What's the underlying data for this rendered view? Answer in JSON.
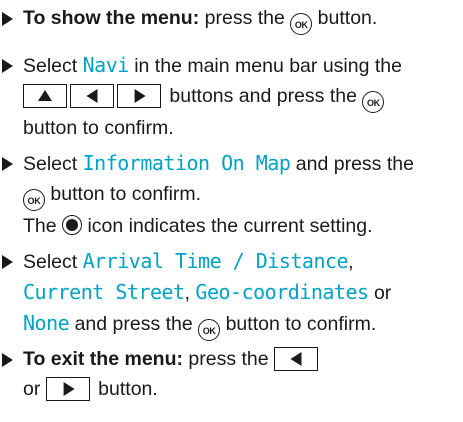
{
  "ok_label": "OK",
  "steps": [
    {
      "bold": "To show the menu:",
      "a": " press the ",
      "b": " button."
    },
    {
      "a": "Select ",
      "hl1": "Navi",
      "b": " in the main menu bar using the",
      "c": " buttons and press the ",
      "d": "button to confirm."
    },
    {
      "a": "Select ",
      "hl1": "Information On Map",
      "b": " and press the",
      "c": " button to confirm.",
      "d": "The ",
      "e": " icon indicates the current setting."
    },
    {
      "a": "Select ",
      "hl1": "Arrival Time / Distance",
      "b": ",",
      "hl2": "Current Street",
      "c": ", ",
      "hl3": "Geo-coordinates",
      "d": " or",
      "hl4": "None",
      "e": " and press the ",
      "f": " button to confirm."
    },
    {
      "bold": "To exit the menu:",
      "a": " press the ",
      "b": "or ",
      "c": " button."
    }
  ],
  "icons": {
    "bullet": "right-triangle-bullet",
    "ok": "ok-button-icon",
    "up": "up-arrow-key",
    "left": "left-arrow-key",
    "right": "right-arrow-key",
    "radio": "selected-radio-icon"
  },
  "colors": {
    "highlight": "#00a3c4",
    "text": "#1a1a1a"
  }
}
